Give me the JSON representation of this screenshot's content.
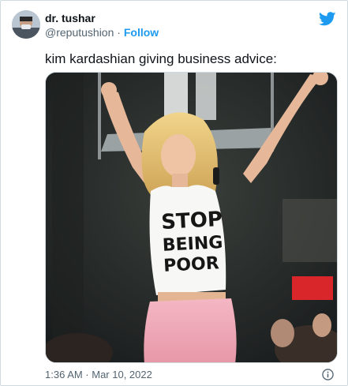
{
  "author": {
    "display_name": "dr. tushar",
    "handle": "@reputushion",
    "separator": "·",
    "follow_label": "Follow"
  },
  "tweet": {
    "text": "kim kardashian giving business advice:",
    "timestamp": "1:36 AM · Mar 10, 2022"
  },
  "media": {
    "shirt_text_lines": [
      "STOP",
      "BEING",
      "POOR"
    ]
  },
  "colors": {
    "accent": "#1d9bf0",
    "text": "#0f1419",
    "muted": "#536471",
    "border": "#cfd9de"
  },
  "icons": {
    "brand": "twitter-bird-icon",
    "info": "info-icon"
  }
}
